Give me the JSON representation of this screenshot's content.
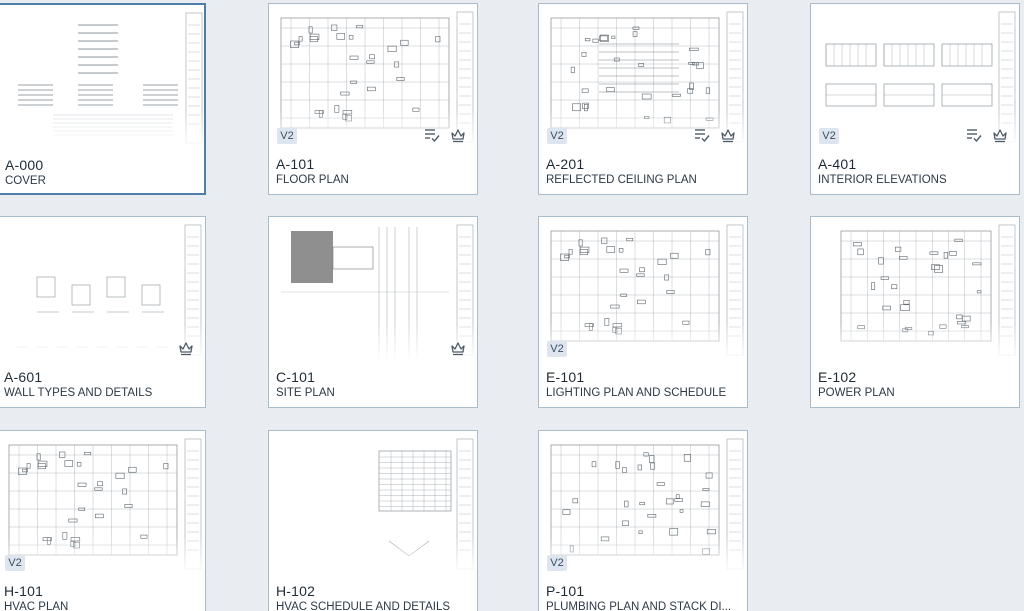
{
  "accent_color": "#4f7fa8",
  "badge_color": "#dde6ee",
  "sheets": [
    {
      "number": "A-000",
      "title": "COVER",
      "version": "",
      "icons": [],
      "thumb": "cover"
    },
    {
      "number": "A-101",
      "title": "FLOOR PLAN",
      "version": "V2",
      "icons": [
        "review-checklist-icon",
        "crown-icon"
      ],
      "thumb": "plan"
    },
    {
      "number": "A-201",
      "title": "REFLECTED CEILING PLAN",
      "version": "V2",
      "icons": [
        "review-checklist-icon",
        "crown-icon"
      ],
      "thumb": "ceiling"
    },
    {
      "number": "A-401",
      "title": "INTERIOR ELEVATIONS",
      "version": "V2",
      "icons": [
        "review-checklist-icon",
        "crown-icon"
      ],
      "thumb": "elevation"
    },
    {
      "number": "A-601",
      "title": "WALL TYPES AND DETAILS",
      "version": "",
      "icons": [
        "crown-icon"
      ],
      "thumb": "details"
    },
    {
      "number": "C-101",
      "title": "SITE PLAN",
      "version": "",
      "icons": [
        "crown-icon"
      ],
      "thumb": "site"
    },
    {
      "number": "E-101",
      "title": "LIGHTING PLAN AND SCHEDULE",
      "version": "V2",
      "icons": [],
      "thumb": "plan"
    },
    {
      "number": "E-102",
      "title": "POWER PLAN",
      "version": "",
      "icons": [],
      "thumb": "power"
    },
    {
      "number": "H-101",
      "title": "HVAC PLAN",
      "version": "V2",
      "icons": [],
      "thumb": "hvac"
    },
    {
      "number": "H-102",
      "title": "HVAC SCHEDULE AND DETAILS",
      "version": "",
      "icons": [],
      "thumb": "schedule"
    },
    {
      "number": "P-101",
      "title": "PLUMBING PLAN AND STACK DI...",
      "version": "V2",
      "icons": [],
      "thumb": "plumbing"
    }
  ]
}
